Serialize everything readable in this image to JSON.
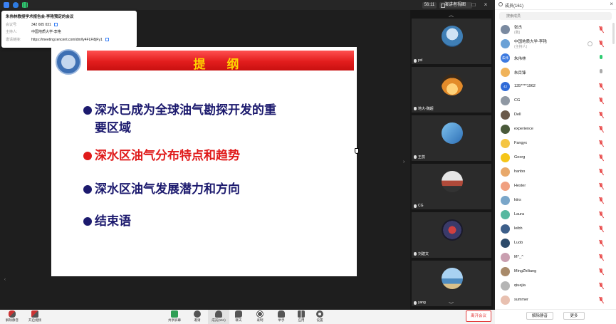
{
  "meeting_info": {
    "title": "朱伟林教授学术报告会-李艳预定的会议",
    "rows": [
      {
        "label": "会议号:",
        "value": "342 605 031"
      },
      {
        "label": "主持人:",
        "value": "中国地质大学-李艳"
      },
      {
        "label": "邀请链接:",
        "value": "https://meeting.tencent.com/dm/ly4FLFi8jFy1"
      }
    ]
  },
  "topbar": {
    "timer": "56:11",
    "view_label": "演讲者视图",
    "minimize": "–",
    "maximize": "□",
    "close": "×"
  },
  "slide": {
    "title": "提 纲",
    "bullets": [
      {
        "line1": "深水已成为全球油气勘探开发的重",
        "line2": "要区域"
      },
      {
        "line1": "深水区油气分布特点和趋势",
        "line2": ""
      },
      {
        "line1": "深水区油气发展潜力和方向",
        "line2": ""
      },
      {
        "line1": "结束语",
        "line2": ""
      }
    ],
    "colors": {
      "title_bar": "#e21d1d",
      "title_text": "#ffd400",
      "bullet_blue": "#1c1a6e",
      "bullet_red": "#e01b1b"
    }
  },
  "strip": {
    "scroll_up": "︿",
    "scroll_down": "﹀",
    "toggle": "›",
    "tiles": [
      {
        "name": "pxl"
      },
      {
        "name": "地大-魏超"
      },
      {
        "name": "王蕊"
      },
      {
        "name": "CG"
      },
      {
        "name": "刘建文"
      },
      {
        "name": "yang"
      }
    ]
  },
  "panel": {
    "title": "成员(161)",
    "close": "×",
    "search_placeholder": "搜索成员",
    "members": [
      {
        "name": "张杰",
        "role": "(我)",
        "avatar": "#7a8aa0",
        "initial": "",
        "mic": "muted"
      },
      {
        "name": "中国地质大学-李艳",
        "role": "(主持人)",
        "avatar": "#6aa1d6",
        "initial": "",
        "mic": "muted"
      },
      {
        "name": "朱伟林",
        "role": "",
        "avatar": "#3e7be0",
        "initial": "朱伟",
        "mic": "active"
      },
      {
        "name": "朱目锋",
        "role": "",
        "avatar": "#f0b35a",
        "initial": "",
        "mic": "normal"
      },
      {
        "name": "135****1962",
        "role": "",
        "avatar": "#2f6bd8",
        "initial": "42",
        "mic": "muted"
      },
      {
        "name": "CG",
        "role": "",
        "avatar": "#8f98a3",
        "initial": "",
        "mic": "muted"
      },
      {
        "name": "Dell",
        "role": "",
        "avatar": "#6b5a4a",
        "initial": "",
        "mic": "muted"
      },
      {
        "name": "experience",
        "role": "",
        "avatar": "#4a5a3a",
        "initial": "",
        "mic": "muted"
      },
      {
        "name": "Fangyx",
        "role": "",
        "avatar": "#f4c542",
        "initial": "",
        "mic": "muted"
      },
      {
        "name": "Georg",
        "role": "",
        "avatar": "#f5c518",
        "initial": "",
        "mic": "muted"
      },
      {
        "name": "hanbo",
        "role": "",
        "avatar": "#e8a86a",
        "initial": "",
        "mic": "muted"
      },
      {
        "name": "Hester",
        "role": "",
        "avatar": "#f0a080",
        "initial": "",
        "mic": "muted"
      },
      {
        "name": "kiirs",
        "role": "",
        "avatar": "#7aa6c9",
        "initial": "",
        "mic": "muted"
      },
      {
        "name": "Laura",
        "role": "",
        "avatar": "#56b8a0",
        "initial": "",
        "mic": "muted"
      },
      {
        "name": "leibh",
        "role": "",
        "avatar": "#3d5f8a",
        "initial": "",
        "mic": "muted"
      },
      {
        "name": "Luob",
        "role": "",
        "avatar": "#2d4a6a",
        "initial": "",
        "mic": "muted"
      },
      {
        "name": "M^_^",
        "role": "",
        "avatar": "#c99fb0",
        "initial": "",
        "mic": "muted"
      },
      {
        "name": "MingZhiliang",
        "role": "",
        "avatar": "#a88a6a",
        "initial": "",
        "mic": "muted"
      },
      {
        "name": "qiuejia",
        "role": "",
        "avatar": "#b5b5b5",
        "initial": "",
        "mic": "muted"
      },
      {
        "name": "summer",
        "role": "",
        "avatar": "#e8c0b0",
        "initial": "",
        "mic": "muted"
      }
    ],
    "footer": {
      "unmute_all": "解除静音",
      "more": "更多"
    }
  },
  "toolbar": {
    "left": [
      {
        "label": "解除静音",
        "name": "unmute-button"
      },
      {
        "label": "开启视频",
        "name": "start-video-button"
      }
    ],
    "center": [
      {
        "label": "共享屏幕",
        "name": "share-screen-button"
      },
      {
        "label": "邀请",
        "name": "invite-button"
      },
      {
        "label": "成员(161)",
        "name": "members-button"
      },
      {
        "label": "聊天",
        "name": "chat-button"
      },
      {
        "label": "录制",
        "name": "record-button"
      },
      {
        "label": "举手",
        "name": "raise-hand-button"
      },
      {
        "label": "应用",
        "name": "apps-button"
      },
      {
        "label": "设置",
        "name": "settings-button"
      }
    ],
    "leave": "离开会议"
  }
}
